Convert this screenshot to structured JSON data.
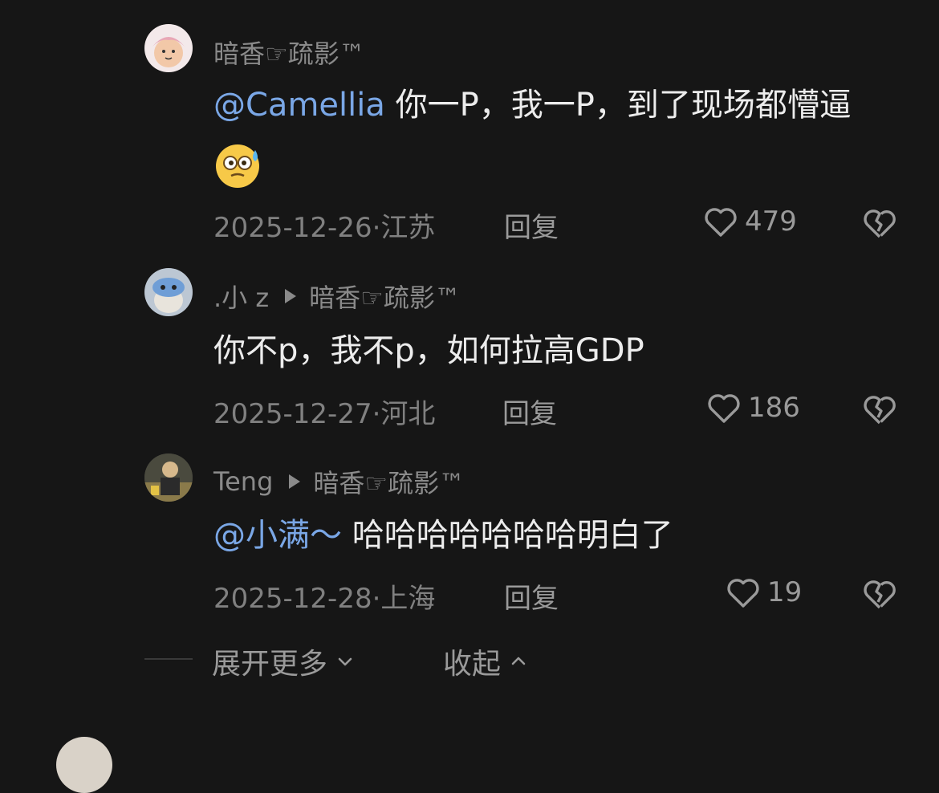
{
  "comments": [
    {
      "username": "暗香☞疏影™",
      "reply_to": "",
      "mention": "@Camellia",
      "text": " 你一P，我一P，到了现场都懵逼",
      "emoji": "dizzy-sweat-face-emoji",
      "date_location": "2025-12-26·江苏",
      "reply_label": "回复",
      "likes": "479"
    },
    {
      "username": ".小 z",
      "reply_to": "暗香☞疏影™",
      "mention": "",
      "text": "你不p，我不p，如何拉高GDP",
      "date_location": "2025-12-27·河北",
      "reply_label": "回复",
      "likes": "186"
    },
    {
      "username": "Teng",
      "reply_to": "暗香☞疏影™",
      "mention": "@小满～",
      "text": " 哈哈哈哈哈哈哈明白了",
      "date_location": "2025-12-28·上海",
      "reply_label": "回复",
      "likes": "19"
    }
  ],
  "footer": {
    "expand_label": "展开更多",
    "collapse_label": "收起"
  },
  "colors": {
    "background": "#161616",
    "mention": "#7aa7e6",
    "meta": "#808080"
  }
}
